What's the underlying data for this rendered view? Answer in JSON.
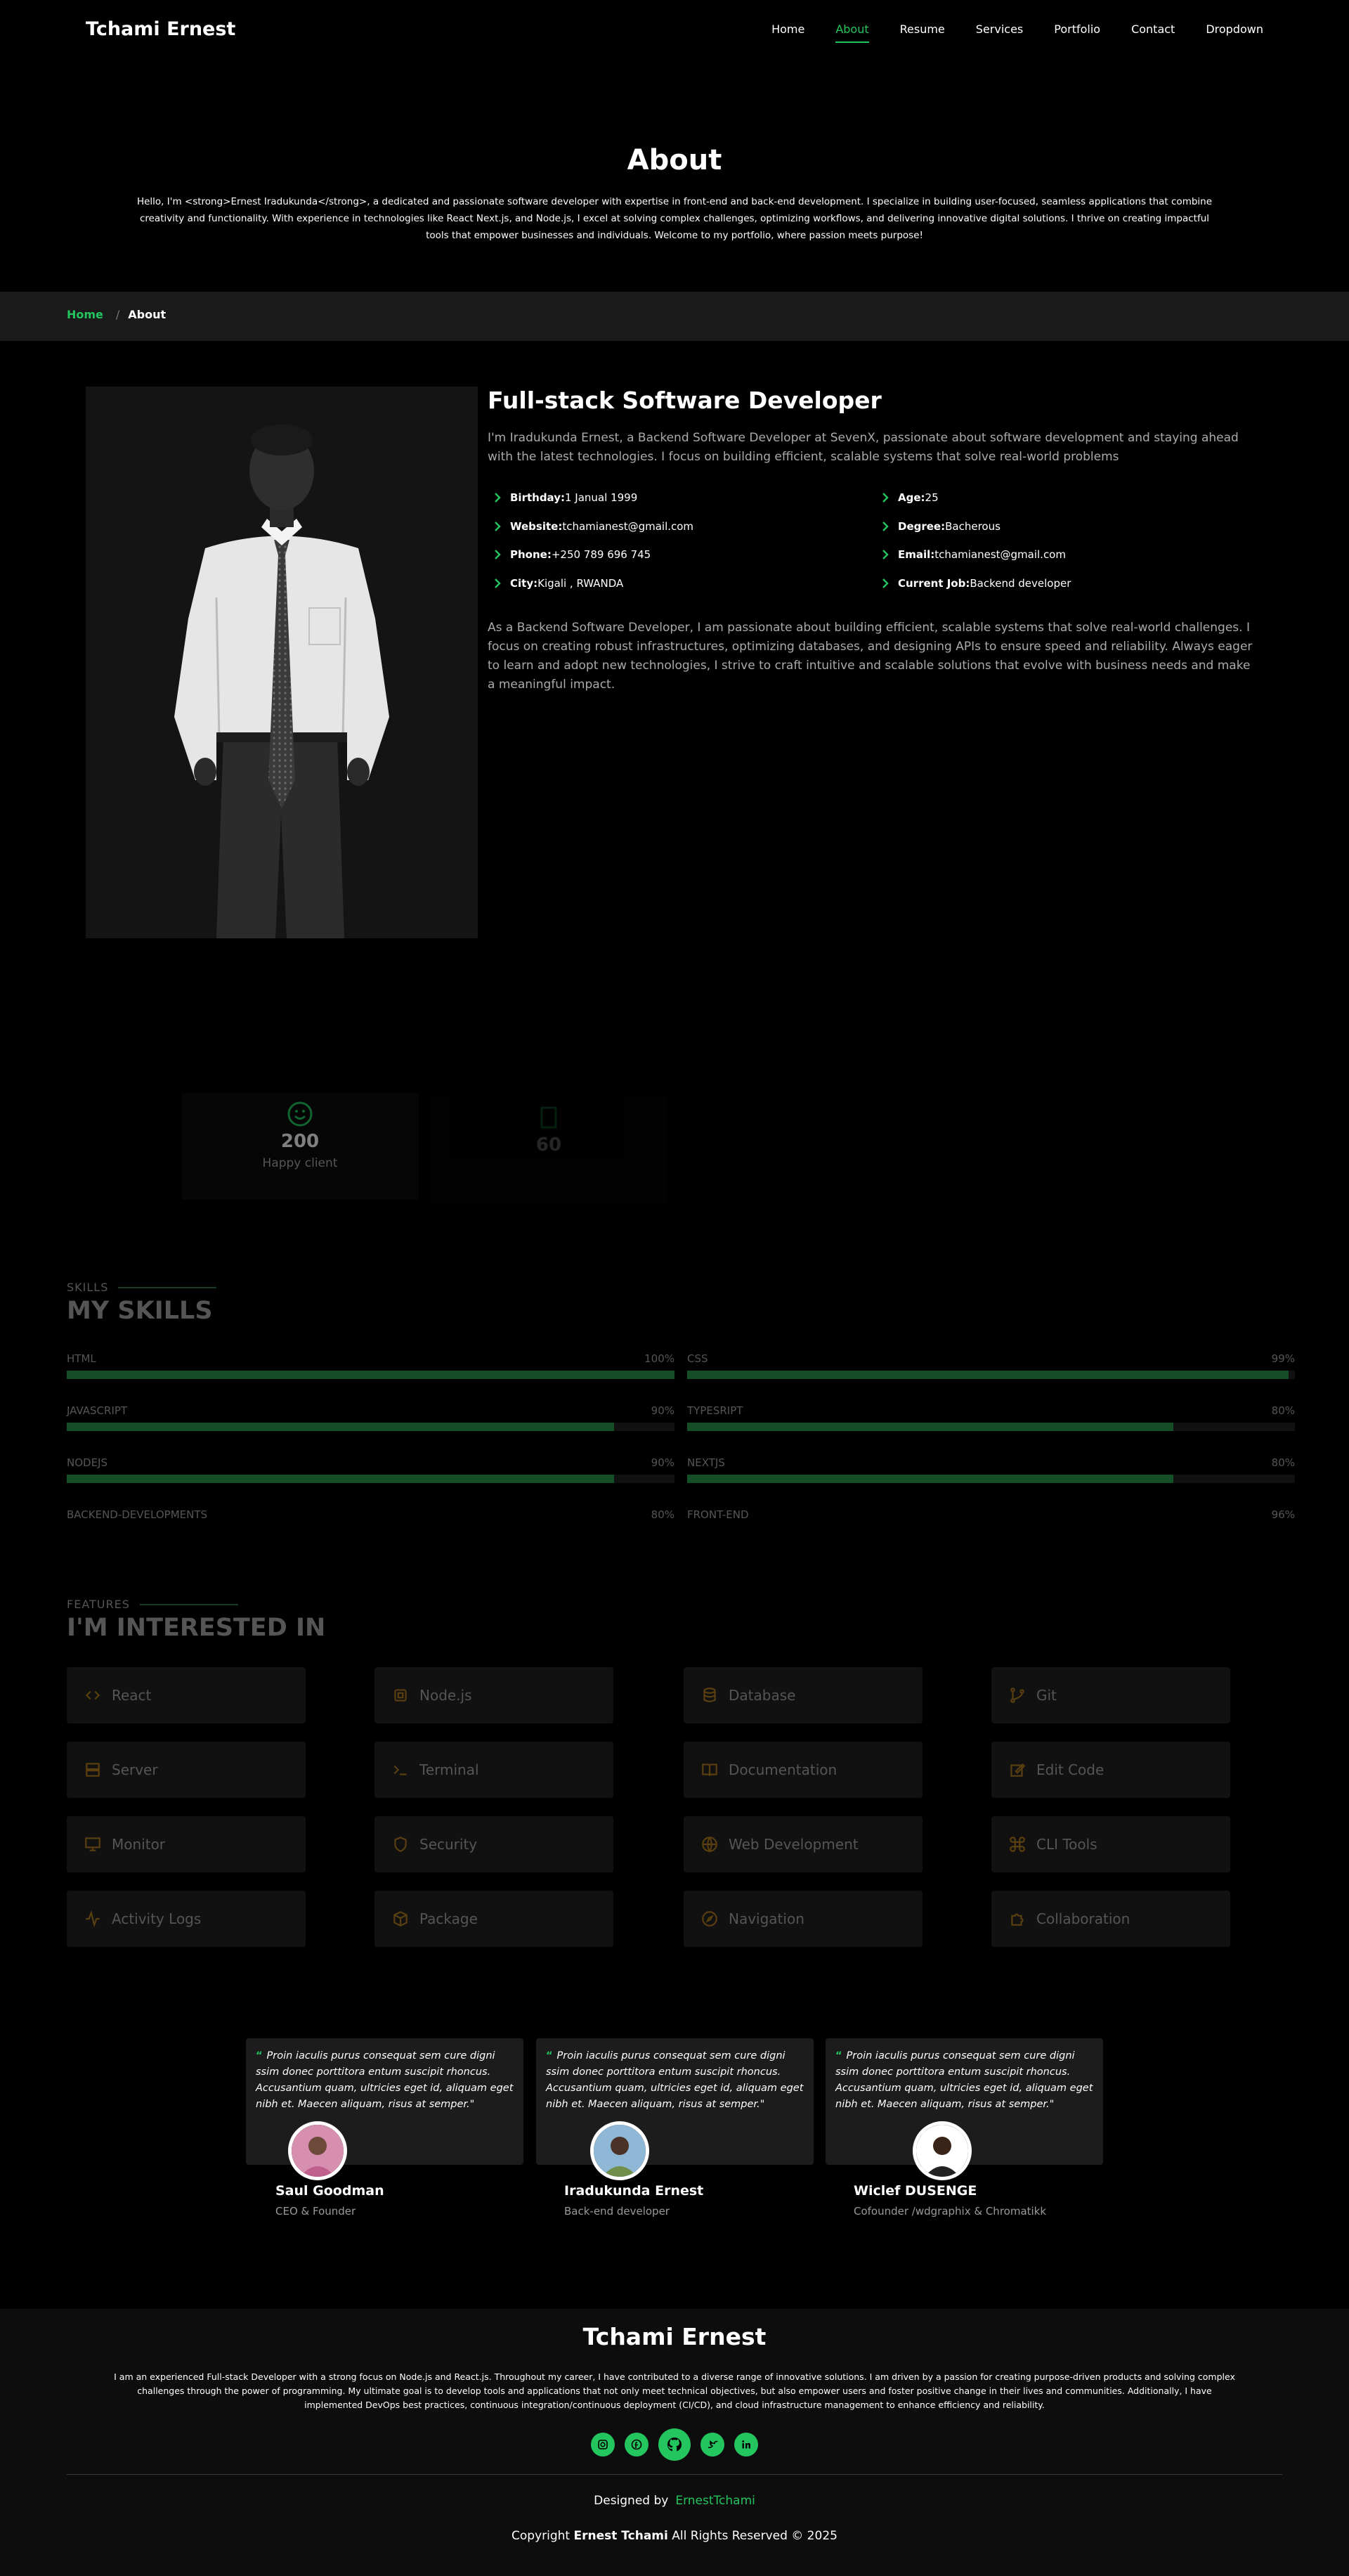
{
  "header": {
    "logo": "Tchami Ernest",
    "nav": [
      {
        "label": "Home",
        "active": false
      },
      {
        "label": "About",
        "active": true
      },
      {
        "label": "Resume",
        "active": false
      },
      {
        "label": "Services",
        "active": false
      },
      {
        "label": "Portfolio",
        "active": false
      },
      {
        "label": "Contact",
        "active": false
      },
      {
        "label": "Dropdown",
        "active": false
      }
    ]
  },
  "hero": {
    "title": "About",
    "intro": "Hello, I'm <strong>Ernest Iradukunda</strong>, a dedicated and passionate software developer with expertise in front-end and back-end development. I specialize in building user-focused, seamless applications that combine creativity and functionality. With experience in technologies like React Next.js, and Node.js, I excel at solving complex challenges, optimizing workflows, and delivering innovative digital solutions. I thrive on creating impactful tools that empower businesses and individuals. Welcome to my portfolio, where passion meets purpose!"
  },
  "breadcrumb": {
    "home": "Home",
    "separator": "/",
    "current": "About"
  },
  "about": {
    "heading": "Full-stack Software Developer",
    "lead": "I'm Iradukunda Ernest, a Backend Software Developer at SevenX, passionate about software development and staying ahead with the latest technologies. I focus on building efficient, scalable systems that solve real-world problems",
    "info_left": [
      {
        "label": "Birthday:",
        "value": "1 Janual 1999"
      },
      {
        "label": "Website:",
        "value": "tchamianest@gmail.com"
      },
      {
        "label": "Phone:",
        "value": "+250 789 696 745"
      },
      {
        "label": "City:",
        "value": "Kigali , RWANDA"
      }
    ],
    "info_right": [
      {
        "label": "Age:",
        "value": "25"
      },
      {
        "label": "Degree:",
        "value": "Bacherous"
      },
      {
        "label": "Email:",
        "value": "tchamianest@gmail.com"
      },
      {
        "label": "Current Job:",
        "value": "Backend developer"
      }
    ],
    "body": "As a Backend Software Developer, I am passionate about building efficient, scalable systems that solve real-world challenges. I focus on creating robust infrastructures, optimizing databases, and designing APIs to ensure speed and reliability. Always eager to learn and adopt new technologies, I strive to craft intuitive and scalable solutions that evolve with business needs and make a meaningful impact."
  },
  "stats": [
    {
      "number": "200",
      "label": "Happy client"
    },
    {
      "number": "60",
      "label": ""
    }
  ],
  "skills": {
    "tag": "SKILLS",
    "title": "MY SKILLS",
    "items": [
      {
        "name": "HTML",
        "percent_label": "100%",
        "percent": 100
      },
      {
        "name": "CSS",
        "percent_label": "99%",
        "percent": 99
      },
      {
        "name": "JAVASCRIPT",
        "percent_label": "90%",
        "percent": 90
      },
      {
        "name": "TYPESRIPT",
        "percent_label": "80%",
        "percent": 80
      },
      {
        "name": "NODEJS",
        "percent_label": "90%",
        "percent": 90
      },
      {
        "name": "NEXTJS",
        "percent_label": "80%",
        "percent": 80
      },
      {
        "name": "BACKEND-DEVELOPMENTS",
        "percent_label": "80%",
        "percent": 80
      },
      {
        "name": "FRONT-END",
        "percent_label": "96%",
        "percent": 96
      }
    ]
  },
  "features": {
    "tag": "FEATURES",
    "title": "I'M INTERESTED IN",
    "items": [
      {
        "label": "React",
        "icon": "code-icon"
      },
      {
        "label": "Node.js",
        "icon": "cpu-icon"
      },
      {
        "label": "Database",
        "icon": "database-icon"
      },
      {
        "label": "Git",
        "icon": "git-branch-icon"
      },
      {
        "label": "Server",
        "icon": "server-icon"
      },
      {
        "label": "Terminal",
        "icon": "terminal-icon"
      },
      {
        "label": "Documentation",
        "icon": "book-icon"
      },
      {
        "label": "Edit Code",
        "icon": "edit-icon"
      },
      {
        "label": "Monitor",
        "icon": "monitor-icon"
      },
      {
        "label": "Security",
        "icon": "shield-icon"
      },
      {
        "label": "Web Development",
        "icon": "globe-icon"
      },
      {
        "label": "CLI Tools",
        "icon": "command-icon"
      },
      {
        "label": "Activity Logs",
        "icon": "activity-icon"
      },
      {
        "label": "Package",
        "icon": "package-icon"
      },
      {
        "label": "Navigation",
        "icon": "compass-icon"
      },
      {
        "label": "Collaboration",
        "icon": "puzzle-icon"
      }
    ]
  },
  "testimonials": [
    {
      "quote": "Proin iaculis purus consequat sem cure digni ssim donec porttitora entum suscipit rhoncus. Accusantium quam, ultricies eget id, aliquam eget nibh et. Maecen aliquam, risus at semper.\"",
      "name": "Saul Goodman",
      "role": "CEO & Founder"
    },
    {
      "quote": "Proin iaculis purus consequat sem cure digni ssim donec porttitora entum suscipit rhoncus. Accusantium quam, ultricies eget id, aliquam eget nibh et. Maecen aliquam, risus at semper.\"",
      "name": "Iradukunda Ernest",
      "role": "Back-end developer"
    },
    {
      "quote": "Proin iaculis purus consequat sem cure digni ssim donec porttitora entum suscipit rhoncus. Accusantium quam, ultricies eget id, aliquam eget nibh et. Maecen aliquam, risus at semper.\"",
      "name": "Wiclef DUSENGE",
      "role": "Cofounder /wdgraphix & Chromatikk"
    }
  ],
  "footer": {
    "title": "Tchami Ernest",
    "text": "I am an experienced Full-stack Developer with a strong focus on Node.js and React.js. Throughout my career, I have contributed to a diverse range of innovative solutions. I am driven by a passion for creating purpose-driven products and solving complex challenges through the power of programming. My ultimate goal is to develop tools and applications that not only meet technical objectives, but also empower users and foster positive change in their lives and communities. Additionally, I have implemented DevOps best practices, continuous integration/continuous deployment (CI/CD), and cloud infrastructure management to enhance efficiency and reliability.",
    "socials": [
      "instagram-icon",
      "facebook-icon",
      "github-icon",
      "twitter-icon",
      "linkedin-icon"
    ],
    "designed_label": "Designed by",
    "designed_author": "ErnestTchami",
    "copyright_prefix": "Copyright",
    "copyright_name": "Ernest Tchami",
    "copyright_suffix": "All Rights Reserved © 2025"
  },
  "colors": {
    "accent": "#22c55e",
    "background": "#000000",
    "panel": "#1a1a1b"
  }
}
